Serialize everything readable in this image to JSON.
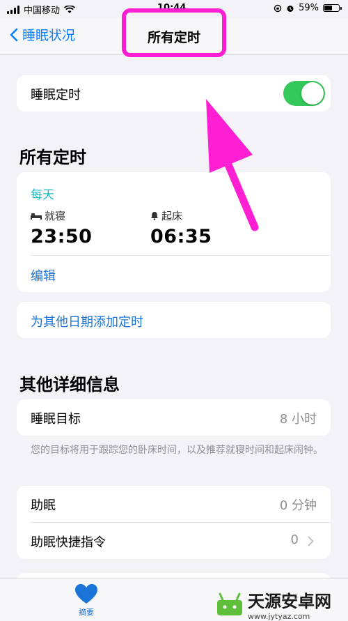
{
  "status_bar": {
    "carrier": "中国移动",
    "time": "10:44",
    "battery_percent": "59%",
    "battery_level": 0.59
  },
  "nav": {
    "back_label": "睡眠状况",
    "title": "所有定时"
  },
  "sleep_schedule": {
    "label": "睡眠定时",
    "enabled": true
  },
  "all_schedules": {
    "section_title": "所有定时",
    "days": "每天",
    "bedtime_label": "就寝",
    "bedtime": "23:50",
    "wake_label": "起床",
    "wake": "06:35",
    "edit_label": "编辑",
    "add_label": "为其他日期添加定时"
  },
  "more_details": {
    "section_title": "其他详细信息",
    "goal_label": "睡眠目标",
    "goal_value": "8 小时",
    "goal_footnote": "您的目标将用于跟踪您的卧床时间，以及推荐就寝时间和起床闹钟。",
    "wind_down_label": "助眠",
    "wind_down_value": "0 分钟",
    "shortcuts_label": "助眠快捷指令",
    "shortcuts_value": "0"
  },
  "tab_bar": {
    "summary_label": "摘要"
  },
  "watermark": {
    "main": "天源安卓网",
    "sub": "www.jytyaz.com"
  },
  "colors": {
    "accent_blue": "#1a73d6",
    "teal": "#16b8c1",
    "toggle_green": "#34c759",
    "annotation_magenta": "#ff1fd2"
  }
}
